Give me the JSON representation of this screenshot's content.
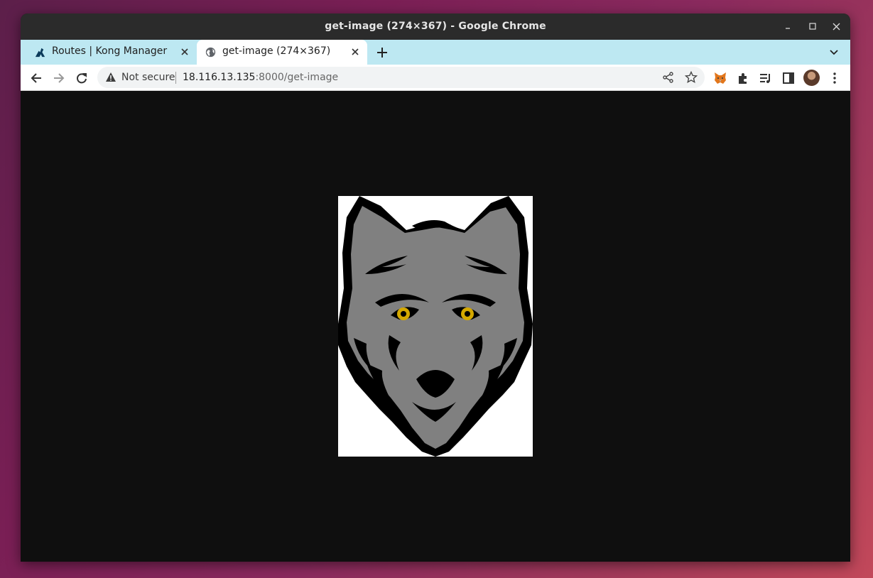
{
  "window": {
    "title": "get-image (274×367) - Google Chrome"
  },
  "tabs": [
    {
      "label": "Routes | Kong Manager",
      "icon": "kong-logo-icon",
      "active": false
    },
    {
      "label": "get-image (274×367)",
      "icon": "globe-icon",
      "active": true
    }
  ],
  "omnibox": {
    "security_label": "Not secure",
    "url_host": "18.116.13.135",
    "url_rest": ":8000/get-image"
  },
  "toolbar_icons": [
    "back-icon",
    "forward-icon",
    "reload-icon",
    "share-icon",
    "star-icon",
    "metamask-fox-icon",
    "extensions-puzzle-icon",
    "media-controls-icon",
    "side-panel-icon",
    "profile-avatar",
    "menu-dots-icon"
  ],
  "image": {
    "description_icon": "wolf-head-image",
    "colors": {
      "fur": "#808080",
      "outline": "#000000",
      "eyes": "#d4a800",
      "background": "#ffffff"
    }
  },
  "colors": {
    "tabbar": "#bde8f2",
    "titlebar": "#2b2b2b",
    "content_bg": "#0f0f0f"
  }
}
